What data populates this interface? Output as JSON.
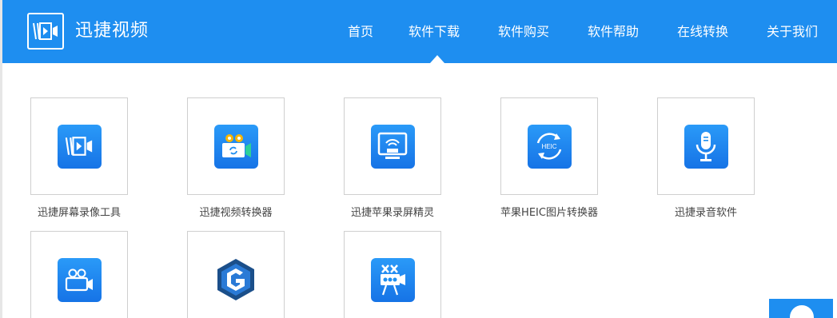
{
  "brand": {
    "name": "迅捷视频",
    "color": "#1e8ef0"
  },
  "nav": {
    "items": [
      {
        "label": "首页"
      },
      {
        "label": "软件下载"
      },
      {
        "label": "软件购买"
      },
      {
        "label": "软件帮助"
      },
      {
        "label": "在线转换"
      },
      {
        "label": "关于我们"
      }
    ],
    "active": "软件下载"
  },
  "products": [
    {
      "label": "迅捷屏幕录像工具",
      "icon": "screen-recorder-icon"
    },
    {
      "label": "迅捷视频转换器",
      "icon": "video-converter-icon"
    },
    {
      "label": "迅捷苹果录屏精灵",
      "icon": "airplay-recorder-icon"
    },
    {
      "label": "苹果HEIC图片转换器",
      "icon": "heic-converter-icon"
    },
    {
      "label": "迅捷录音软件",
      "icon": "microphone-icon"
    },
    {
      "label": "",
      "icon": "video-camera-icon"
    },
    {
      "label": "",
      "icon": "hexagon-g-logo-icon"
    },
    {
      "label": "",
      "icon": "film-projector-icon"
    }
  ],
  "heic_badge": "HEIC"
}
